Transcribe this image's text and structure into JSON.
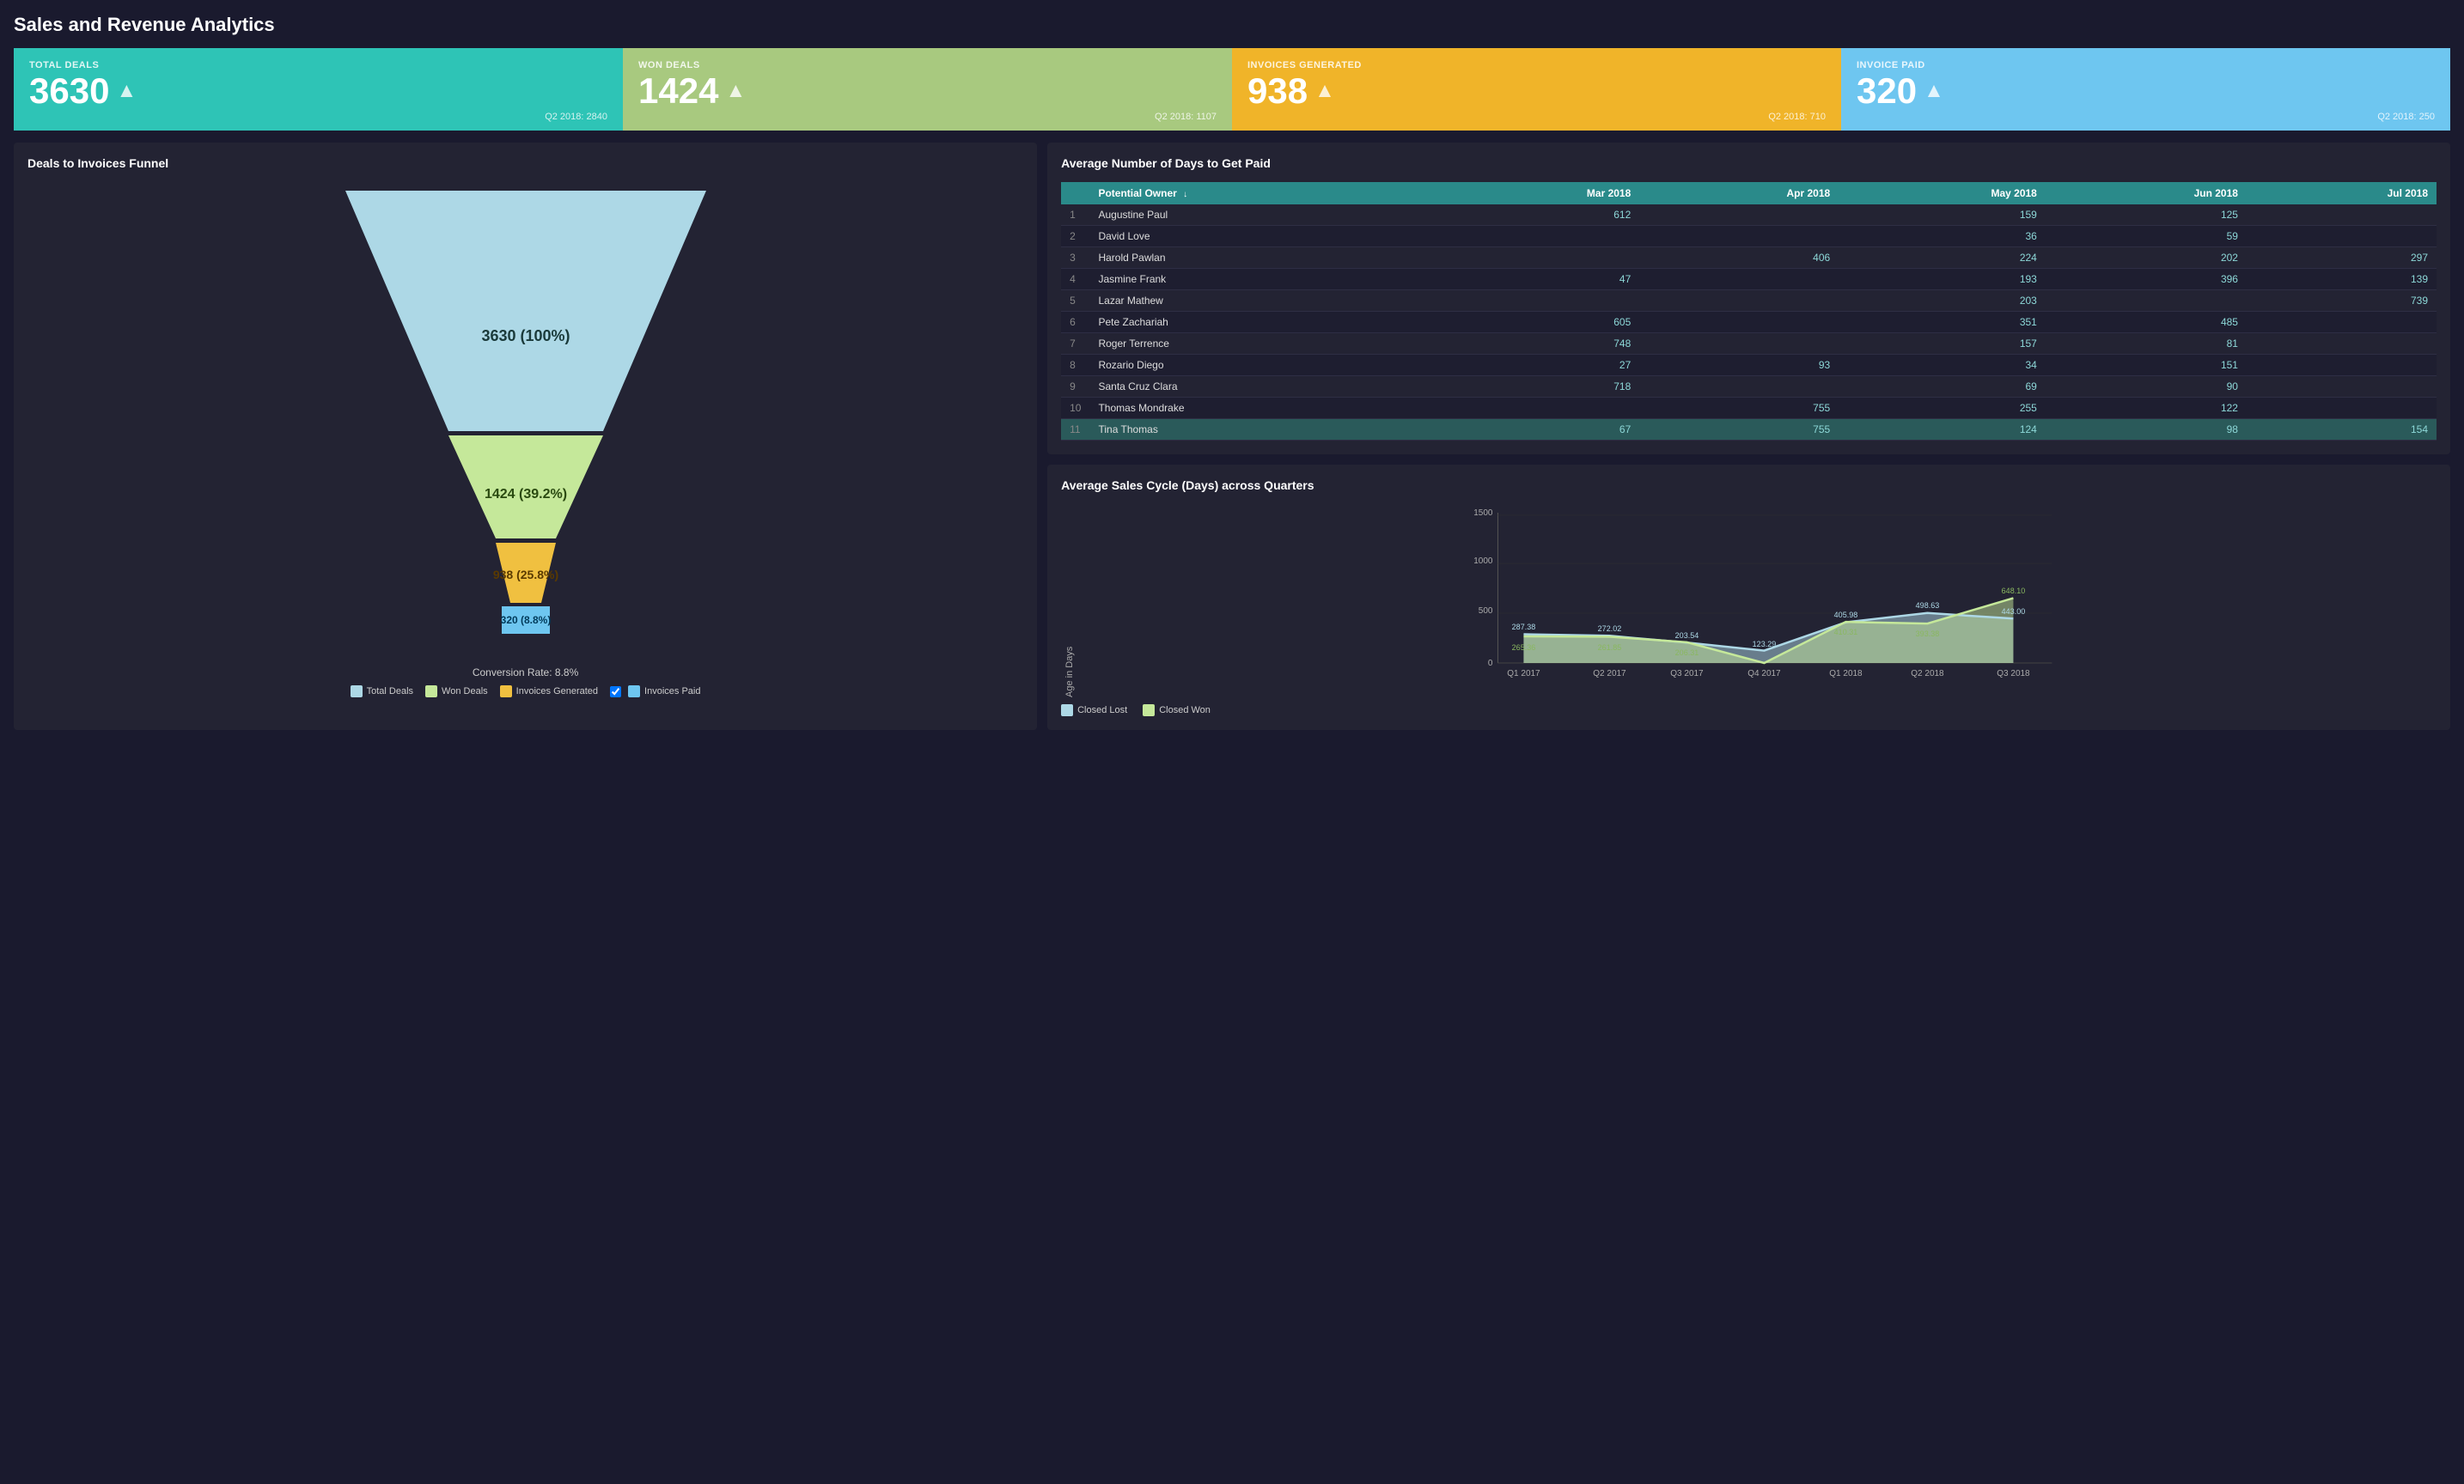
{
  "page": {
    "title": "Sales and Revenue Analytics"
  },
  "kpis": [
    {
      "id": "total-deals",
      "label": "TOTAL DEALS",
      "value": "3630",
      "color": "teal",
      "sub": "Q2 2018: 2840"
    },
    {
      "id": "won-deals",
      "label": "WON DEALS",
      "value": "1424",
      "color": "green",
      "sub": "Q2 2018: 1107"
    },
    {
      "id": "invoices-generated",
      "label": "INVOICES GENERATED",
      "value": "938",
      "color": "gold",
      "sub": "Q2 2018: 710"
    },
    {
      "id": "invoice-paid",
      "label": "INVOICE PAID",
      "value": "320",
      "color": "blue",
      "sub": "Q2 2018: 250"
    }
  ],
  "funnel": {
    "title": "Deals to Invoices Funnel",
    "segments": [
      {
        "label": "Total Deals",
        "value": 3630,
        "pct": "100%",
        "color": "#add8e6"
      },
      {
        "label": "Won Deals",
        "value": 1424,
        "pct": "39.2%",
        "color": "#c5e89a"
      },
      {
        "label": "Invoices Generated",
        "value": 938,
        "pct": "25.8%",
        "color": "#f0c040"
      },
      {
        "label": "Invoices Paid",
        "value": 320,
        "pct": "8.8%",
        "color": "#6ec6f0"
      }
    ],
    "conversion_rate": "Conversion Rate: 8.8%"
  },
  "table": {
    "title": "Average Number of Days to Get Paid",
    "columns": [
      "",
      "Potential Owner",
      "Mar 2018",
      "Apr 2018",
      "May 2018",
      "Jun 2018",
      "Jul 2018"
    ],
    "rows": [
      {
        "num": 1,
        "name": "Augustine Paul",
        "mar": "612",
        "apr": "",
        "may": "159",
        "jun": "125",
        "jul": ""
      },
      {
        "num": 2,
        "name": "David Love",
        "mar": "",
        "apr": "",
        "may": "36",
        "jun": "59",
        "jul": ""
      },
      {
        "num": 3,
        "name": "Harold Pawlan",
        "mar": "",
        "apr": "406",
        "may": "224",
        "jun": "202",
        "jul": "297"
      },
      {
        "num": 4,
        "name": "Jasmine Frank",
        "mar": "47",
        "apr": "",
        "may": "193",
        "jun": "396",
        "jul": "139"
      },
      {
        "num": 5,
        "name": "Lazar Mathew",
        "mar": "",
        "apr": "",
        "may": "203",
        "jun": "",
        "jul": "739"
      },
      {
        "num": 6,
        "name": "Pete Zachariah",
        "mar": "605",
        "apr": "",
        "may": "351",
        "jun": "485",
        "jul": ""
      },
      {
        "num": 7,
        "name": "Roger Terrence",
        "mar": "748",
        "apr": "",
        "may": "157",
        "jun": "81",
        "jul": ""
      },
      {
        "num": 8,
        "name": "Rozario Diego",
        "mar": "27",
        "apr": "93",
        "may": "34",
        "jun": "151",
        "jul": ""
      },
      {
        "num": 9,
        "name": "Santa Cruz Clara",
        "mar": "718",
        "apr": "",
        "may": "69",
        "jun": "90",
        "jul": ""
      },
      {
        "num": 10,
        "name": "Thomas Mondrake",
        "mar": "",
        "apr": "755",
        "may": "255",
        "jun": "122",
        "jul": ""
      },
      {
        "num": 11,
        "name": "Tina Thomas",
        "mar": "67",
        "apr": "755",
        "may": "124",
        "jun": "98",
        "jul": "154",
        "highlight": true
      }
    ]
  },
  "chart": {
    "title": "Average Sales Cycle (Days) across Quarters",
    "y_label": "Age in Days",
    "y_max": 1500,
    "x_labels": [
      "Q1 2017",
      "Q2 2017",
      "Q3 2017",
      "Q4 2017",
      "Q1 2018",
      "Q2 2018",
      "Q3 2018"
    ],
    "series": [
      {
        "name": "Closed Lost",
        "color": "#add8e6",
        "values": [
          287.38,
          272.02,
          203.54,
          123.29,
          405.98,
          498.63,
          443.0
        ]
      },
      {
        "name": "Closed Won",
        "color": "#c5e89a",
        "values": [
          265.36,
          261.85,
          206.31,
          0,
          410.31,
          393.38,
          648.1
        ]
      }
    ],
    "y_ticks": [
      0,
      500,
      1000,
      1500
    ]
  },
  "legend": {
    "conversion_label": "Conversion Rate: 8.8%",
    "items": [
      {
        "label": "Total Deals",
        "color": "#add8e6"
      },
      {
        "label": "Won Deals",
        "color": "#c5e89a"
      },
      {
        "label": "Invoices Generated",
        "color": "#f0c040"
      },
      {
        "label": "Invoices Paid",
        "color": "#6ec6f0",
        "checkbox": true
      }
    ]
  }
}
